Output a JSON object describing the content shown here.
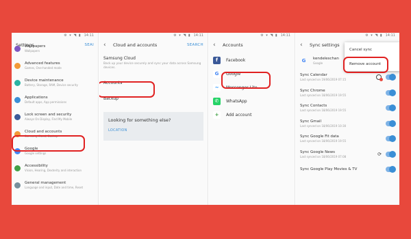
{
  "status": {
    "time": "14:11",
    "icons": "⚙ ▾ ◥ ▮"
  },
  "panel1": {
    "title": "Settings",
    "search_label": "SEAI",
    "items": [
      {
        "title": "Wallpapers",
        "sub": "Wallpapers",
        "color": "#7e57c2"
      },
      {
        "title": "Advanced features",
        "sub": "Games, One-handed mode",
        "color": "#f29a38"
      },
      {
        "title": "Device maintenance",
        "sub": "Battery, Storage, RAM, Device security",
        "color": "#2bb3a3"
      },
      {
        "title": "Applications",
        "sub": "Default apps, App permissions",
        "color": "#3b8fd6"
      },
      {
        "title": "Lock screen and security",
        "sub": "Always On Display, Find My Mobile",
        "color": "#3d5a98"
      },
      {
        "title": "Cloud and accounts",
        "sub": "Samsung Cloud, Backup",
        "color": "#f29a38"
      },
      {
        "title": "Google",
        "sub": "Google settings",
        "color": "#4285f4"
      },
      {
        "title": "Accessibility",
        "sub": "Vision, Hearing, Dexterity and interaction",
        "color": "#43a047"
      },
      {
        "title": "General management",
        "sub": "Language and input, Date and time, Reset",
        "color": "#78909c"
      }
    ]
  },
  "panel2": {
    "title": "Cloud and accounts",
    "action": "SEARCH",
    "samsung_cloud": {
      "title": "Samsung Cloud",
      "sub": "Back up your device securely and sync your data across Samsung devices."
    },
    "accounts": "Accounts",
    "backup": "Backup",
    "looking": {
      "title": "Looking for something else?",
      "link": "LOCATION"
    }
  },
  "panel3": {
    "title": "Accounts",
    "items": [
      {
        "label": "Facebook",
        "icon": "f",
        "bg": "#3b5998",
        "fg": "#ffffff"
      },
      {
        "label": "Google",
        "icon": "G",
        "bg": "#ffffff",
        "fg": "#4285f4"
      },
      {
        "label": "Messenger Lite",
        "icon": "~",
        "bg": "#ffffff",
        "fg": "#0084ff"
      },
      {
        "label": "WhatsApp",
        "icon": "✆",
        "bg": "#25d366",
        "fg": "#ffffff"
      },
      {
        "label": "Add account",
        "icon": "+",
        "bg": "#ffffff",
        "fg": "#43a047"
      }
    ]
  },
  "panel4": {
    "title": "Sync settings",
    "account": {
      "name": "kendeleschan",
      "sub": "Google"
    },
    "popup": {
      "cancel": "Cancel sync",
      "remove": "Remove account"
    },
    "items": [
      {
        "title": "Sync Calendar",
        "sub": "Last synced on 19/06/2019 07:15",
        "ind": "err"
      },
      {
        "title": "Sync Chrome",
        "sub": "Last synced on 18/06/2019 19:55",
        "ind": ""
      },
      {
        "title": "Sync Contacts",
        "sub": "Last synced on 18/06/2019 19:55",
        "ind": ""
      },
      {
        "title": "Sync Gmail",
        "sub": "Last synced on 18/06/2019 10:30",
        "ind": ""
      },
      {
        "title": "Sync Google Fit data",
        "sub": "Last synced on 18/06/2019 19:55",
        "ind": ""
      },
      {
        "title": "Sync Google News",
        "sub": "Last synced on 18/06/2019 07:08",
        "ind": "sync"
      },
      {
        "title": "Sync Google Play Movies & TV",
        "sub": "",
        "ind": ""
      }
    ]
  }
}
